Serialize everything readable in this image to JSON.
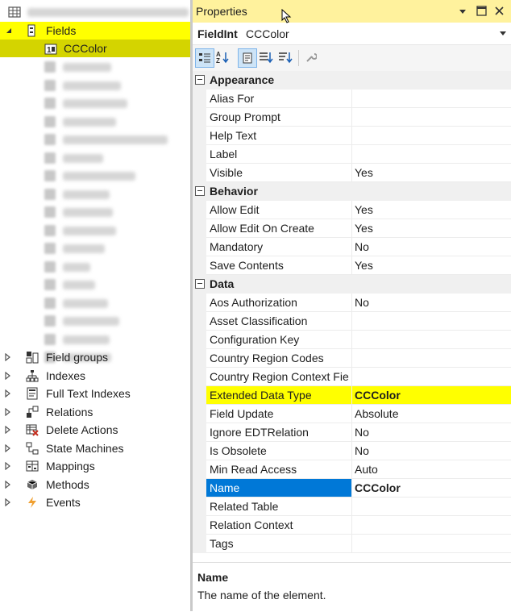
{
  "tree": {
    "root_label_blurred": true,
    "fields": {
      "label": "Fields"
    },
    "selected_field": {
      "label": "CCColor"
    },
    "nodes": [
      {
        "label": "Field groups",
        "icon": "field-groups-icon"
      },
      {
        "label": "Indexes",
        "icon": "indexes-icon"
      },
      {
        "label": "Full Text Indexes",
        "icon": "full-text-indexes-icon"
      },
      {
        "label": "Relations",
        "icon": "relations-icon"
      },
      {
        "label": "Delete Actions",
        "icon": "delete-actions-icon"
      },
      {
        "label": "State Machines",
        "icon": "state-machines-icon"
      },
      {
        "label": "Mappings",
        "icon": "mappings-icon"
      },
      {
        "label": "Methods",
        "icon": "methods-icon"
      },
      {
        "label": "Events",
        "icon": "events-icon"
      }
    ]
  },
  "properties": {
    "title": "Properties",
    "object_type": "FieldInt",
    "object_name": "CCColor",
    "categories": [
      {
        "label": "Appearance",
        "rows": [
          {
            "name": "Alias For",
            "value": ""
          },
          {
            "name": "Group Prompt",
            "value": ""
          },
          {
            "name": "Help Text",
            "value": ""
          },
          {
            "name": "Label",
            "value": ""
          },
          {
            "name": "Visible",
            "value": "Yes"
          }
        ]
      },
      {
        "label": "Behavior",
        "rows": [
          {
            "name": "Allow Edit",
            "value": "Yes"
          },
          {
            "name": "Allow Edit On Create",
            "value": "Yes"
          },
          {
            "name": "Mandatory",
            "value": "No"
          },
          {
            "name": "Save Contents",
            "value": "Yes"
          }
        ]
      },
      {
        "label": "Data",
        "rows": [
          {
            "name": "Aos Authorization",
            "value": "No"
          },
          {
            "name": "Asset Classification",
            "value": ""
          },
          {
            "name": "Configuration Key",
            "value": ""
          },
          {
            "name": "Country Region Codes",
            "value": ""
          },
          {
            "name": "Country Region Context Fie",
            "value": ""
          },
          {
            "name": "Extended Data Type",
            "value": "CCColor",
            "bold": true,
            "highlight": "yellow"
          },
          {
            "name": "Field Update",
            "value": "Absolute"
          },
          {
            "name": "Ignore EDTRelation",
            "value": "No"
          },
          {
            "name": "Is Obsolete",
            "value": "No"
          },
          {
            "name": "Min Read Access",
            "value": "Auto"
          },
          {
            "name": "Name",
            "value": "CCColor",
            "bold": true,
            "selected": true
          },
          {
            "name": "Related Table",
            "value": ""
          },
          {
            "name": "Relation Context",
            "value": ""
          },
          {
            "name": "Tags",
            "value": ""
          }
        ]
      }
    ],
    "description": {
      "title": "Name",
      "text": "The name of the element."
    }
  },
  "colors": {
    "highlight_yellow": "#ffff00",
    "selection_blue": "#0078d7",
    "title_bar_yellow": "#fff29d"
  }
}
